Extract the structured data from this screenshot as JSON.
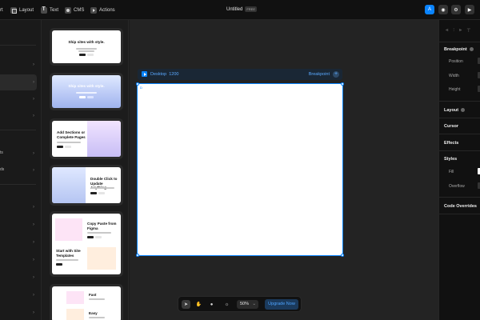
{
  "topbar": {
    "insert_partial": "rt",
    "layout_label": "Layout",
    "text_label": "Text",
    "cms_label": "CMS",
    "actions_label": "Actions",
    "doc_title": "Untitled",
    "plan_badge": "FREE",
    "avatar_initial": "A"
  },
  "sidebar": {
    "items": [
      {
        "label": ""
      },
      {
        "label": ""
      },
      {
        "label": ""
      },
      {
        "label": ""
      },
      {
        "label": "ts"
      },
      {
        "label": "ds"
      },
      {
        "label": ""
      },
      {
        "label": ""
      },
      {
        "label": ""
      },
      {
        "label": ""
      },
      {
        "label": ""
      },
      {
        "label": ""
      },
      {
        "label": ""
      }
    ]
  },
  "templates": [
    {
      "heading": "Ship sites with style."
    },
    {
      "heading": "Ship sites with style."
    },
    {
      "heading": "Add Sections or Complete Pages"
    },
    {
      "heading": "Double Click to Update Anything"
    },
    {
      "heading": "Copy Paste from Figma",
      "heading2": "Start with Site Templates"
    },
    {
      "heading": "Fast",
      "heading2": "Easy"
    }
  ],
  "canvas": {
    "frame_name": "Desktop",
    "frame_width": "1200",
    "breakpoint_label": "Breakpoint",
    "frame_tag": "D"
  },
  "toolbar": {
    "zoom": "50%",
    "upgrade_label": "Upgrade Now"
  },
  "inspector": {
    "breakpoint_title": "Breakpoint",
    "position_label": "Position",
    "width_label": "Width",
    "height_label": "Height",
    "layout_title": "Layout",
    "cursor_title": "Cursor",
    "effects_title": "Effects",
    "styles_title": "Styles",
    "fill_label": "Fill",
    "overflow_label": "Overflow",
    "code_overrides_title": "Code Overrides"
  },
  "colors": {
    "accent": "#0a84ff",
    "panel": "#111111",
    "canvas": "#232323"
  }
}
